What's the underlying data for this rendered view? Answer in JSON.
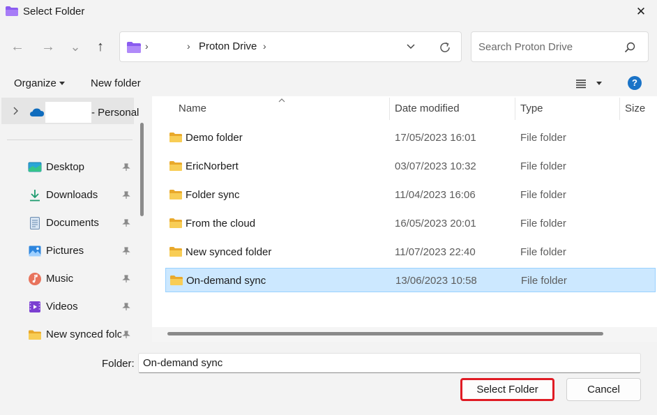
{
  "window": {
    "title": "Select Folder",
    "close_glyph": "✕"
  },
  "nav_buttons": {
    "back": "←",
    "forward": "→",
    "recent": "⌄",
    "up": "↑"
  },
  "address": {
    "sep": "›",
    "crumb": "Proton Drive"
  },
  "search": {
    "placeholder": "Search Proton Drive"
  },
  "commands": {
    "organize": "Organize",
    "new_folder": "New folder",
    "help": "?"
  },
  "nav": {
    "onedrive_label": "- Personal",
    "items": [
      {
        "label": "Desktop",
        "icon": "desktop-icon"
      },
      {
        "label": "Downloads",
        "icon": "download-icon"
      },
      {
        "label": "Documents",
        "icon": "document-icon"
      },
      {
        "label": "Pictures",
        "icon": "pictures-icon"
      },
      {
        "label": "Music",
        "icon": "music-icon"
      },
      {
        "label": "Videos",
        "icon": "videos-icon"
      },
      {
        "label": "New synced folc",
        "icon": "folder-icon"
      }
    ]
  },
  "columns": {
    "name": "Name",
    "date": "Date modified",
    "type": "Type",
    "size": "Size"
  },
  "files": [
    {
      "name": "Demo folder",
      "date": "17/05/2023 16:01",
      "type": "File folder"
    },
    {
      "name": "EricNorbert",
      "date": "03/07/2023 10:32",
      "type": "File folder"
    },
    {
      "name": "Folder sync",
      "date": "11/04/2023 16:06",
      "type": "File folder"
    },
    {
      "name": "From the cloud",
      "date": "16/05/2023 20:01",
      "type": "File folder"
    },
    {
      "name": "New synced folder",
      "date": "11/07/2023 22:40",
      "type": "File folder"
    },
    {
      "name": "On-demand sync",
      "date": "13/06/2023 10:58",
      "type": "File folder",
      "selected": true
    }
  ],
  "footer": {
    "folder_label": "Folder:",
    "folder_value": "On-demand sync",
    "select_button": "Select Folder",
    "cancel_button": "Cancel"
  },
  "colors": {
    "accent": "#e01b24",
    "selection": "#cce8ff",
    "folder": "#f6c342",
    "proton": "#7b4fe0"
  }
}
